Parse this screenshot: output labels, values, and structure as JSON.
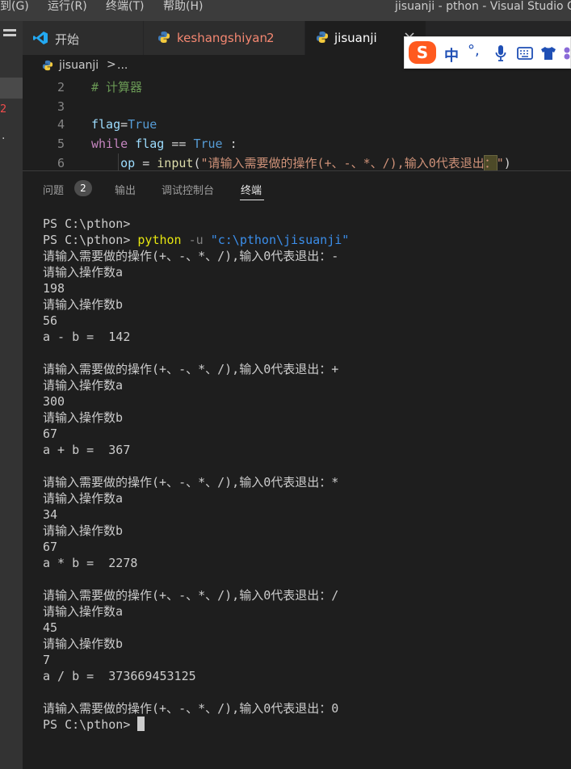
{
  "titlebar": {
    "menu": [
      "转到(G)",
      "运行(R)",
      "终端(T)",
      "帮助(H)"
    ],
    "window_title": "jisuanji - pthon - Visual Studio Code"
  },
  "activitybar": {
    "badge_count": "2",
    "dot": "."
  },
  "tabs": [
    {
      "label": "开始",
      "icon": "vscode-logo-icon"
    },
    {
      "label": "keshangshiyan",
      "icon": "python-icon",
      "problems": "2"
    },
    {
      "label": "jisuanji",
      "icon": "python-icon",
      "active": true
    }
  ],
  "breadcrumb": {
    "file": "jisuanji",
    "separator": ">",
    "more": "..."
  },
  "editor": {
    "line_numbers": [
      "2",
      "3",
      "4",
      "5",
      "6"
    ],
    "lines": {
      "l2_comment": "# 计算器",
      "l4_var": "flag",
      "l4_op": "=",
      "l4_val": "True",
      "l5_kw": "while",
      "l5_var": "flag",
      "l5_op": " == ",
      "l5_val": "True",
      "l5_end": " :",
      "l6_indent": "    ",
      "l6_var": "op",
      "l6_op": " = ",
      "l6_fn": "input",
      "l6_paren": "(",
      "l6_str": "\"请输入需要做的操作(+、-、*、/),输入0代表退出",
      "l6_hl": "：",
      "l6_strend": "\"",
      "l6_close": ")"
    }
  },
  "panel": {
    "tabs": [
      "问题",
      "输出",
      "调试控制台",
      "终端"
    ],
    "problems_count": "2",
    "active_tab": "终端"
  },
  "terminal": {
    "prompt": "PS C:\\pthon>",
    "cmd_python": "python",
    "cmd_flag": " -u ",
    "cmd_path": "\"c:\\pthon\\jisuanji\"",
    "lines": [
      "PS C:\\pthon>",
      "__CMD__",
      "请输入需要做的操作(+、-、*、/),输入0代表退出：-",
      "请输入操作数a",
      "198",
      "请输入操作数b",
      "56",
      "a - b =  142",
      "",
      "请输入需要做的操作(+、-、*、/),输入0代表退出：+",
      "请输入操作数a",
      "300",
      "请输入操作数b",
      "67",
      "a + b =  367",
      "",
      "请输入需要做的操作(+、-、*、/),输入0代表退出：*",
      "请输入操作数a",
      "34",
      "请输入操作数b",
      "67",
      "a * b =  2278",
      "",
      "请输入需要做的操作(+、-、*、/),输入0代表退出：/",
      "请输入操作数a",
      "45",
      "请输入操作数b",
      "7",
      "a / b =  373669453125",
      "",
      "请输入需要做的操作(+、-、*、/),输入0代表退出：0",
      "__PROMPT__"
    ]
  },
  "ime": {
    "logo": "S",
    "mode": "中",
    "punct": "°,"
  },
  "colors": {
    "accent": "#007acc",
    "ime_orange": "#ff5a1f",
    "error": "#f14c4c"
  }
}
